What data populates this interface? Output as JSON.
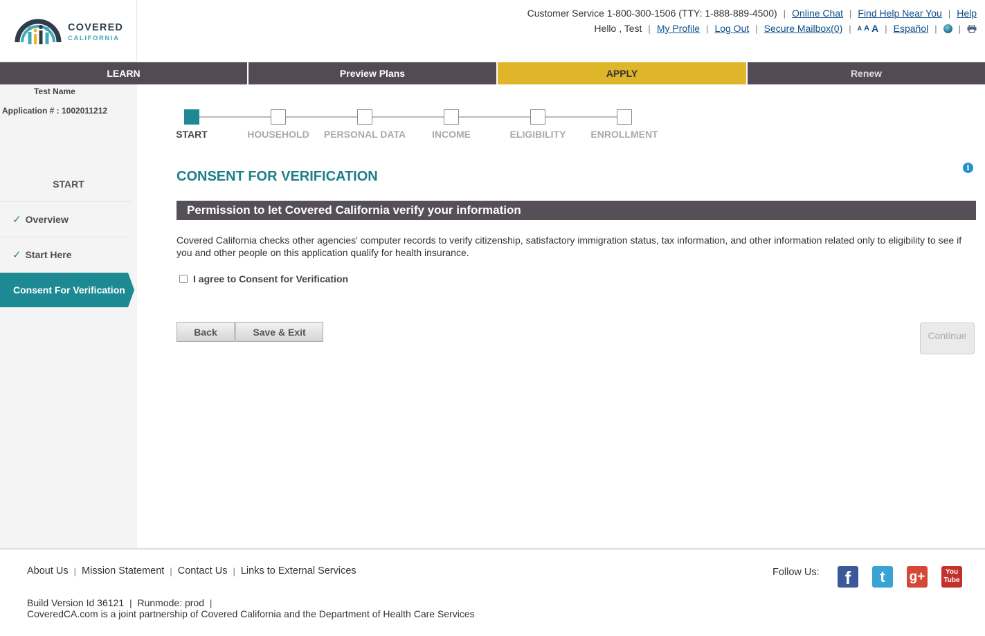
{
  "brand": {
    "line1": "COVERED",
    "line2": "CALIFORNIA",
    "colors": {
      "teal": "#1d8a93",
      "dark": "#524a55",
      "gold": "#dfb52a",
      "link": "#0d4f8b"
    }
  },
  "utility": {
    "customer_service": "Customer Service 1-800-300-1506 (TTY: 1-888-889-4500)",
    "online_chat": "Online Chat",
    "find_help": "Find Help Near You",
    "help": "Help",
    "greeting": "Hello , Test",
    "my_profile": "My Profile",
    "log_out": "Log Out",
    "secure_mailbox": "Secure Mailbox(0)",
    "font_small": "A",
    "font_medium": "A",
    "font_large": "A",
    "espanol": "Español"
  },
  "nav": {
    "learn": "LEARN",
    "preview": "Preview Plans",
    "apply": "APPLY",
    "renew": "Renew"
  },
  "sidebar": {
    "name": "Test Name",
    "application": "Application # : 1002011212",
    "section": "START",
    "items": [
      {
        "label": "Overview",
        "done": true
      },
      {
        "label": "Start Here",
        "done": true
      },
      {
        "label": "Consent For Verification",
        "active": true
      }
    ]
  },
  "progress": {
    "steps": [
      "START",
      "HOUSEHOLD",
      "PERSONAL DATA",
      "INCOME",
      "ELIGIBILITY",
      "ENROLLMENT"
    ],
    "current_index": 0
  },
  "main": {
    "title": "CONSENT FOR VERIFICATION",
    "section_header": "Permission to let Covered California verify your information",
    "body": "Covered California checks other agencies' computer records to verify citizenship, satisfactory immigration status, tax information, and other information related only to eligibility to see if you and other people on this application qualify for health insurance.",
    "consent_label": "I agree to Consent for Verification",
    "consent_checked": false,
    "back": "Back",
    "save_exit": "Save & Exit",
    "continue": "Continue"
  },
  "footer": {
    "links": [
      "About Us",
      "Mission Statement",
      "Contact Us",
      "Links to External Services"
    ],
    "follow_us": "Follow Us:",
    "build": "Build Version Id 36121",
    "runmode": "Runmode: prod",
    "partnership": "CoveredCA.com is a joint partnership of Covered California and the Department of Health Care Services"
  }
}
